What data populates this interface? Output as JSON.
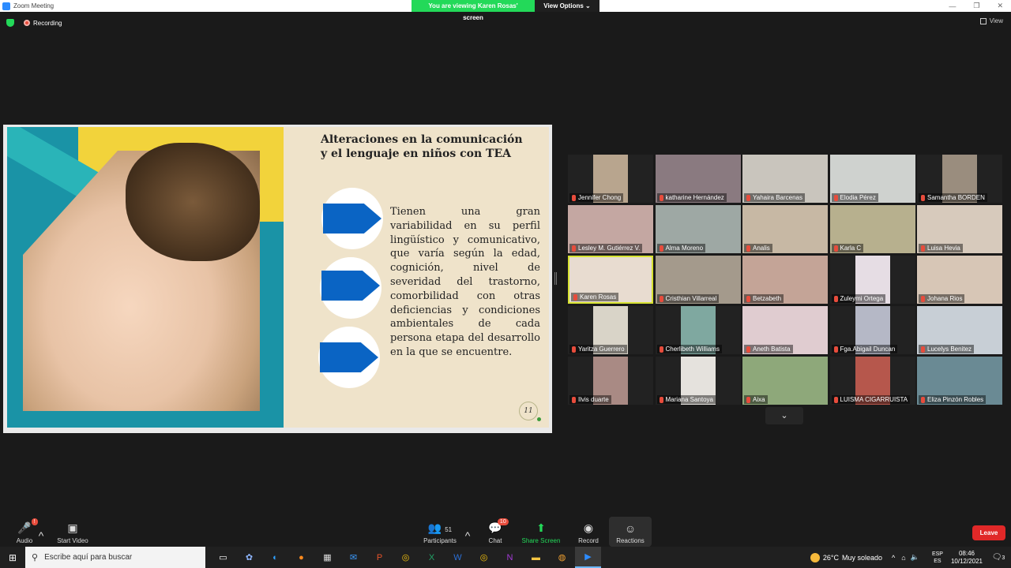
{
  "window": {
    "title": "Zoom Meeting",
    "minimize": "—",
    "restore": "❐",
    "close": "✕"
  },
  "banner": {
    "viewing": "You are viewing Karen Rosas' screen",
    "view_options": "View Options ⌄"
  },
  "status": {
    "recording": "Recording",
    "view_label": "View"
  },
  "slide": {
    "title": "Alteraciones en la comunicación y el lenguaje en niños con TEA",
    "body": "Tienen una gran variabilidad en su perfil lingüístico y comunicativo, que varía según la edad, cognición, nivel de severidad del trastorno, comorbilidad con otras deficiencias y condiciones ambientales de cada persona etapa del desarrollo en la que se encuentre.",
    "page": "11",
    "colors": {
      "arrow": "#0a64c4",
      "background": "#efe3ca"
    }
  },
  "participants": [
    {
      "name": "Jennifer Chong",
      "color": "#b8a58e"
    },
    {
      "name": "katharine Hernández",
      "color": "#8a7a80"
    },
    {
      "name": "Yahaira Barcenas",
      "color": "#c9c5bd"
    },
    {
      "name": "Elodia Pérez",
      "color": "#cfd2cf"
    },
    {
      "name": "Samantha BORDEN",
      "color": "#9a8d7e"
    },
    {
      "name": "Lesley M. Gutiérrez V.",
      "color": "#c4a7a2"
    },
    {
      "name": "Alma Moreno",
      "color": "#9ea8a4"
    },
    {
      "name": "Analis",
      "color": "#c7b8a4"
    },
    {
      "name": "Karla C",
      "color": "#b7b08e"
    },
    {
      "name": "Luisa Hevia",
      "color": "#d7cabc"
    },
    {
      "name": "Karen Rosas",
      "color": "#e8dcd0"
    },
    {
      "name": "Cristhian Villarreal",
      "color": "#a49a8c"
    },
    {
      "name": "Betzabeth",
      "color": "#c4a497"
    },
    {
      "name": "Zuleymi Ortega",
      "color": "#e6dde4"
    },
    {
      "name": "Johana Rios",
      "color": "#d7c6b6"
    },
    {
      "name": "Yaritza Guerrero",
      "color": "#d9d4c8"
    },
    {
      "name": "Cherlibeth Williams",
      "color": "#7fa8a0"
    },
    {
      "name": "Aneth Batista",
      "color": "#e0ccd0"
    },
    {
      "name": "Fga.Abigail Duncan",
      "color": "#b5b8c6"
    },
    {
      "name": "Lucelys Benitez",
      "color": "#c8cfd6"
    },
    {
      "name": "Ilvis duarte",
      "color": "#a98a84"
    },
    {
      "name": "Mariana Santoya",
      "color": "#e5e2dd"
    },
    {
      "name": "Aixa",
      "color": "#8ea87a"
    },
    {
      "name": "LUISMA CIGARRUISTA",
      "color": "#b6574c"
    },
    {
      "name": "Eliza Pinzón Robles",
      "color": "#6a8a94"
    }
  ],
  "toolbar": {
    "audio": "Audio",
    "audio_badge": "!",
    "start_video": "Start Video",
    "participants": "Participants",
    "participants_count": "51",
    "chat": "Chat",
    "chat_badge": "10",
    "share_screen": "Share Screen",
    "record": "Record",
    "reactions": "Reactions",
    "leave": "Leave"
  },
  "taskbar": {
    "search_placeholder": "Escribe aquí para buscar",
    "weather_temp": "26°C",
    "weather_desc": "Muy soleado",
    "lang_top": "ESP",
    "lang_bottom": "ES",
    "time": "08:46",
    "date": "10/12/2021",
    "notif_count": "3"
  }
}
